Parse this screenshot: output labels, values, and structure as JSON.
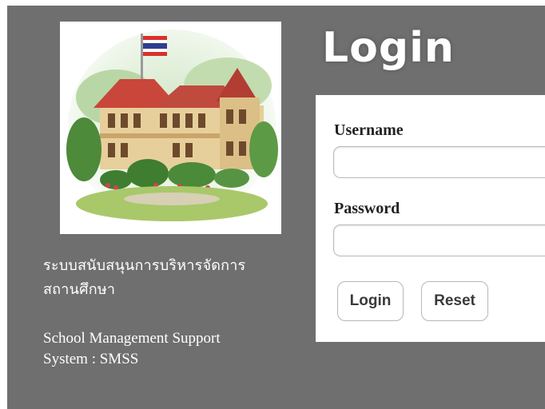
{
  "left": {
    "thai_title_line1": "ระบบสนับสนุนการบริหารจัดการ",
    "thai_title_line2": "สถานศึกษา",
    "english_title_line1": "School Management Support",
    "english_title_line2": "System : SMSS"
  },
  "login": {
    "heading": "Login",
    "username_label": "Username",
    "username_value": "",
    "password_label": "Password",
    "password_value": "",
    "login_button": "Login",
    "reset_button": "Reset"
  },
  "colors": {
    "panel_background": "#6f6f6f",
    "form_background": "#ffffff",
    "text_light": "#ffffff"
  }
}
